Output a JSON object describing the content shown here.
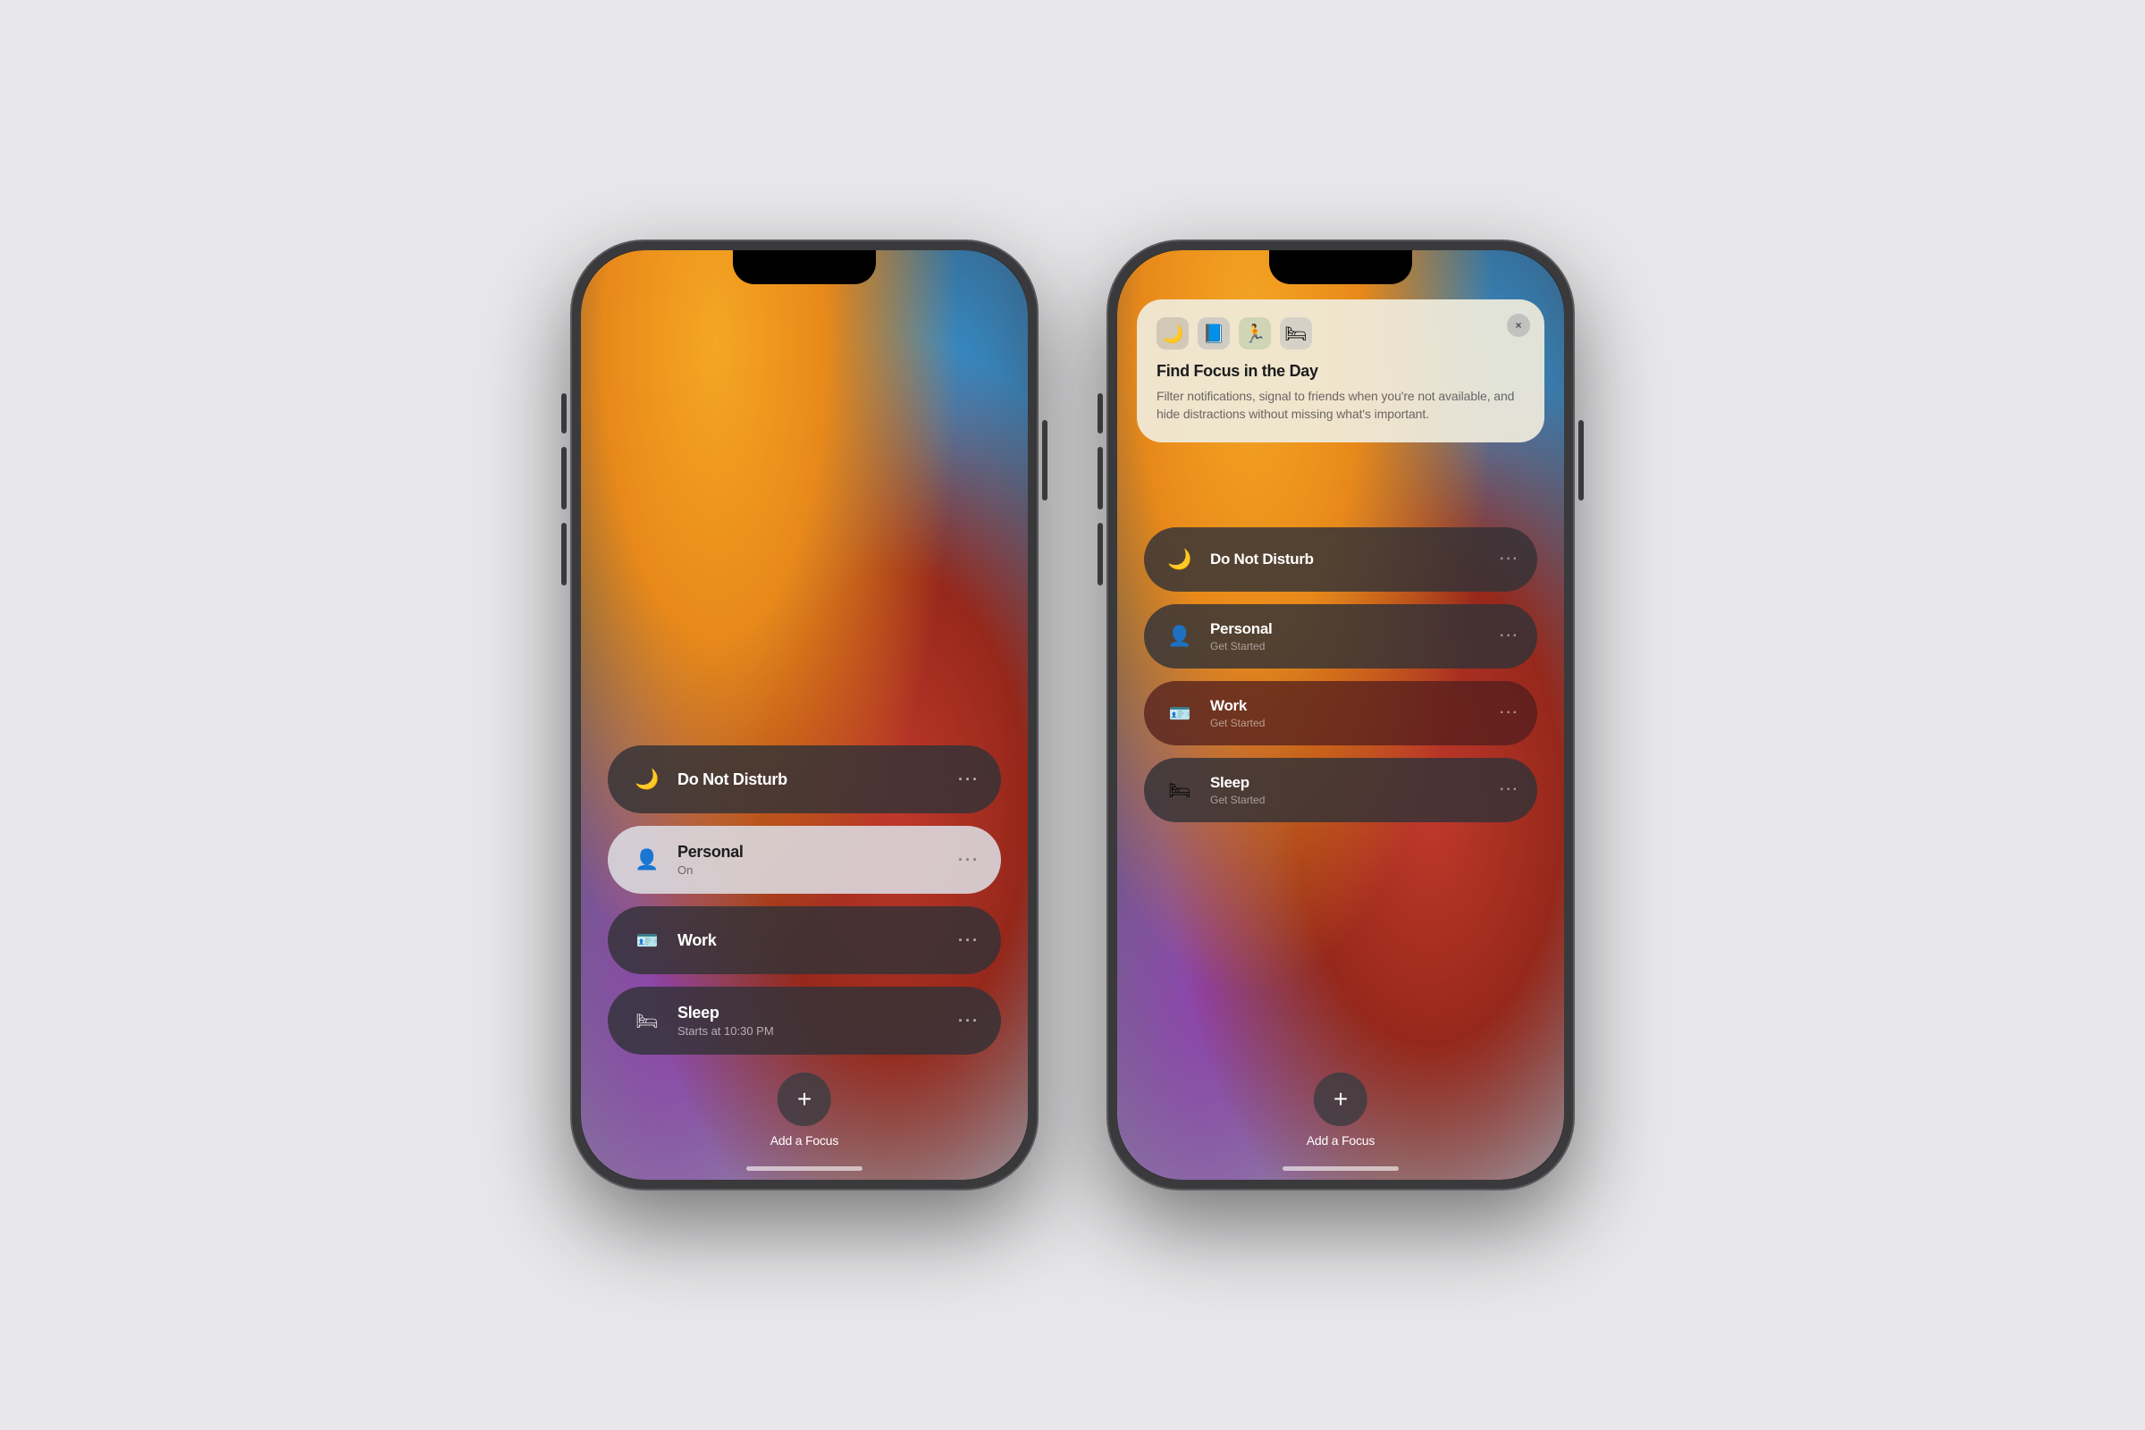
{
  "page": {
    "background": "#e8e8ea"
  },
  "phone_left": {
    "focus_items": [
      {
        "id": "do-not-disturb",
        "name": "Do Not Disturb",
        "sub": "",
        "icon": "🌙",
        "active": false,
        "more": "···"
      },
      {
        "id": "personal",
        "name": "Personal",
        "sub": "On",
        "icon": "👤",
        "active": true,
        "more": "···"
      },
      {
        "id": "work",
        "name": "Work",
        "sub": "",
        "icon": "🪪",
        "active": false,
        "more": "···"
      },
      {
        "id": "sleep",
        "name": "Sleep",
        "sub": "Starts at 10:30 PM",
        "icon": "🛏",
        "active": false,
        "more": "···"
      }
    ],
    "add_label": "Add a Focus",
    "add_icon": "+"
  },
  "phone_right": {
    "info_card": {
      "title": "Find Focus in the Day",
      "description": "Filter notifications, signal to friends when you're not available, and hide distractions without missing what's important.",
      "close_label": "×",
      "icons": [
        "🌙",
        "📘",
        "🏃",
        "🛏"
      ]
    },
    "focus_items": [
      {
        "id": "do-not-disturb",
        "name": "Do Not Disturb",
        "sub": "",
        "icon": "🌙",
        "more": "···",
        "style": "normal"
      },
      {
        "id": "personal",
        "name": "Personal",
        "sub": "Get Started",
        "icon": "👤",
        "more": "···",
        "style": "normal"
      },
      {
        "id": "work",
        "name": "Work",
        "sub": "Get Started",
        "icon": "🪪",
        "more": "···",
        "style": "work"
      },
      {
        "id": "sleep",
        "name": "Sleep",
        "sub": "Get Started",
        "icon": "🛏",
        "more": "···",
        "style": "normal"
      }
    ],
    "add_label": "Add a Focus",
    "add_icon": "+"
  }
}
